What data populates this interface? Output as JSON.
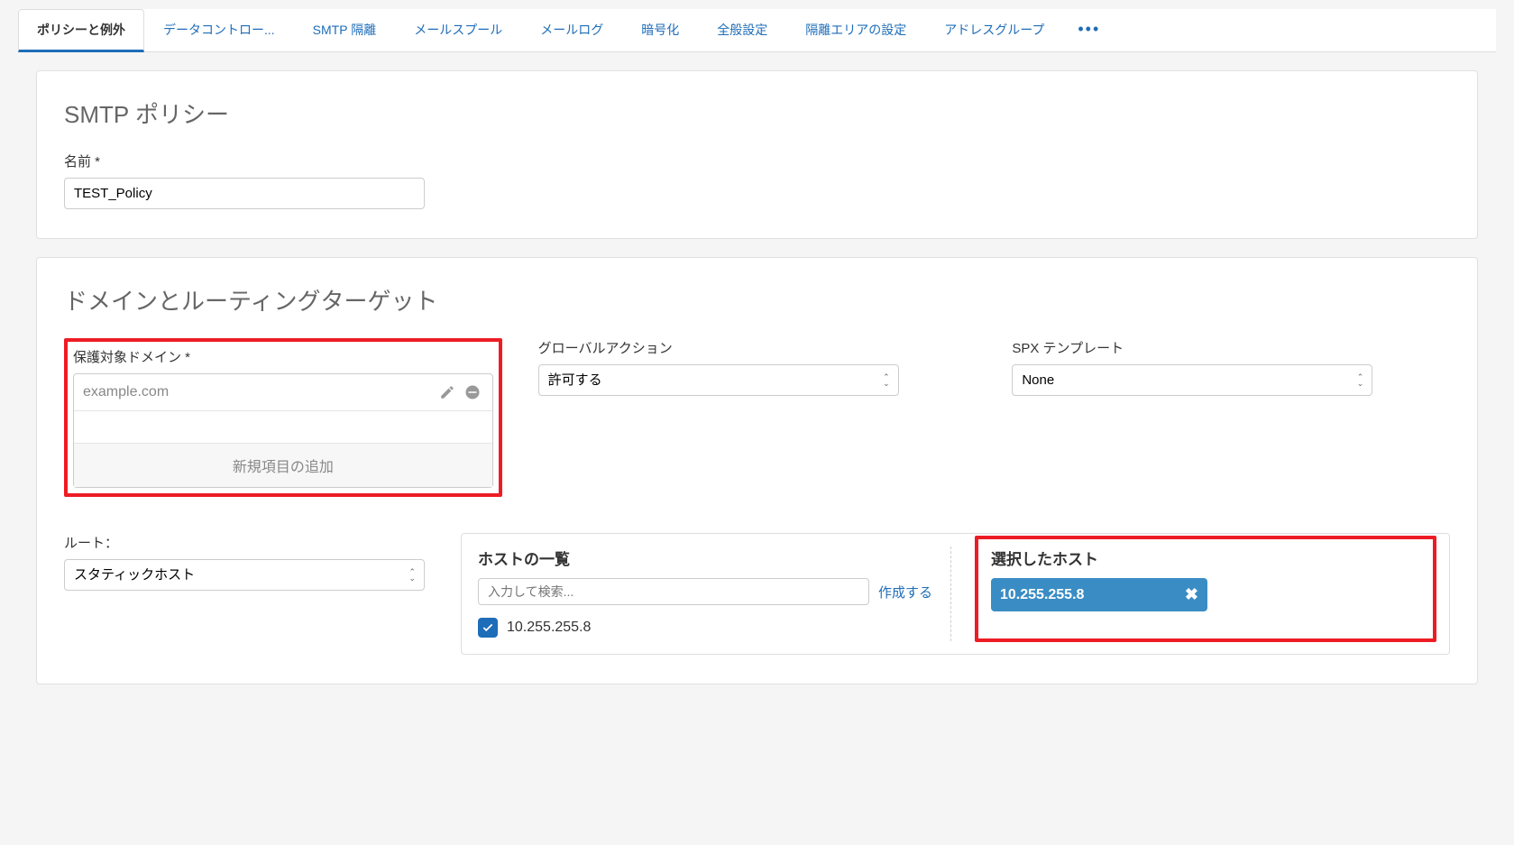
{
  "tabs": {
    "t0": "ポリシーと例外",
    "t1": "データコントロー...",
    "t2": "SMTP 隔離",
    "t3": "メールスプール",
    "t4": "メールログ",
    "t5": "暗号化",
    "t6": "全般設定",
    "t7": "隔離エリアの設定",
    "t8": "アドレスグループ",
    "more": "•••"
  },
  "policy": {
    "header": "SMTP ポリシー",
    "name_label": "名前 *",
    "name_value": "TEST_Policy"
  },
  "routing": {
    "header": "ドメインとルーティングターゲット",
    "domain_label": "保護対象ドメイン *",
    "domain_value": "example.com",
    "add_item": "新規項目の追加",
    "global_action_label": "グローバルアクション",
    "global_action_value": "許可する",
    "spx_label": "SPX テンプレート",
    "spx_value": "None",
    "route_label": "ルート：",
    "route_value": "スタティックホスト",
    "host_list_label": "ホストの一覧",
    "selected_host_label": "選択したホスト",
    "search_placeholder": "入力して検索...",
    "create_link": "作成する",
    "host_ip": "10.255.255.8",
    "chip_ip": "10.255.255.8"
  }
}
